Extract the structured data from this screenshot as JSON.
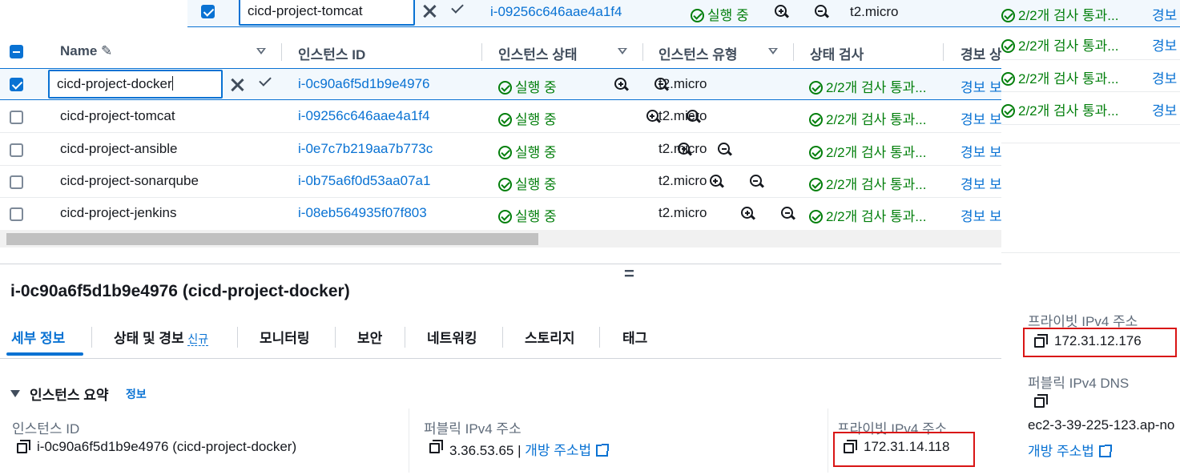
{
  "overlay_row": {
    "name_edit_value": "cicd-project-tomcat",
    "instance_id": "i-09256c646aae4a1f4",
    "state": "실행 중",
    "type": "t2.micro",
    "status_check": "2/2개 검사 통과...",
    "alarm": "경보"
  },
  "right_status_checks": [
    "2/2개 검사 통과...",
    "2/2개 검사 통과...",
    "2/2개 검사 통과...",
    "2/2개 검사 통과..."
  ],
  "right_alarm": "경보",
  "table": {
    "headers": {
      "name": "Name",
      "instance_id": "인스턴스 ID",
      "state": "인스턴스 상태",
      "type": "인스턴스 유형",
      "status_check": "상태 검사",
      "alarm": "경보 상"
    },
    "selected_name_edit": "cicd-project-docker",
    "rows": [
      {
        "name": "cicd-project-docker",
        "id": "i-0c90a6f5d1b9e4976",
        "state": "실행 중",
        "type": "t2.micro",
        "check": "2/2개 검사 통과...",
        "alarm": "경보 보",
        "selected": true
      },
      {
        "name": "cicd-project-tomcat",
        "id": "i-09256c646aae4a1f4",
        "state": "실행 중",
        "type": "t2.micro",
        "check": "2/2개 검사 통과...",
        "alarm": "경보 보",
        "selected": false
      },
      {
        "name": "cicd-project-ansible",
        "id": "i-0e7c7b219aa7b773c",
        "state": "실행 중",
        "type": "t2.micro",
        "check": "2/2개 검사 통과...",
        "alarm": "경보 보",
        "selected": false
      },
      {
        "name": "cicd-project-sonarqube",
        "id": "i-0b75a6f0d53aa07a1",
        "state": "실행 중",
        "type": "t2.micro",
        "check": "2/2개 검사 통과...",
        "alarm": "경보 보",
        "selected": false
      },
      {
        "name": "cicd-project-jenkins",
        "id": "i-08eb564935f07f803",
        "state": "실행 중",
        "type": "t2.micro",
        "check": "2/2개 검사 통과...",
        "alarm": "경보 보",
        "selected": false
      }
    ]
  },
  "splitter_glyph": "=",
  "detail": {
    "title": "i-0c90a6f5d1b9e4976 (cicd-project-docker)",
    "tabs": [
      "세부 정보",
      "상태 및 경보",
      "모니터링",
      "보안",
      "네트워킹",
      "스토리지",
      "태그"
    ],
    "new_badge": "신규",
    "section_title": "인스턴스 요약",
    "section_info": "정보",
    "fields": {
      "instance_id_label": "인스턴스 ID",
      "instance_id_value": "i-0c90a6f5d1b9e4976 (cicd-project-docker)",
      "public_ipv4_label": "퍼블릭 IPv4 주소",
      "public_ipv4_value": "3.36.53.65",
      "open_address": "개방 주소법",
      "private_ipv4_label": "프라이빗 IPv4 주소",
      "private_ipv4_value": "172.31.14.118"
    }
  },
  "right_detail": {
    "private_ipv4_label": "프라이빗 IPv4 주소",
    "private_ipv4_value": "172.31.12.176",
    "public_dns_label": "퍼블릭 IPv4 DNS",
    "public_dns_value": "ec2-3-39-225-123.ap-no",
    "open_address": "개방 주소법"
  },
  "colors": {
    "link": "#0972d3",
    "success": "#037f0c",
    "highlight_box": "#d91515",
    "selected_row": "#f2f8fd"
  }
}
